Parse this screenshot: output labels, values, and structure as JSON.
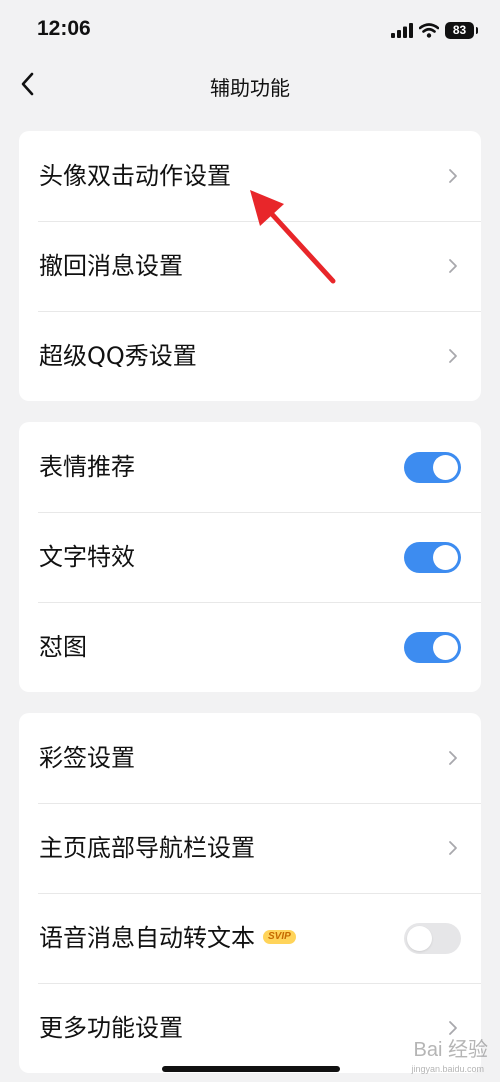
{
  "status": {
    "time": "12:06",
    "battery": "83"
  },
  "nav": {
    "title": "辅助功能"
  },
  "groups": [
    {
      "items": [
        {
          "label": "头像双击动作设置",
          "control": "chevron"
        },
        {
          "label": "撤回消息设置",
          "control": "chevron"
        },
        {
          "label": "超级QQ秀设置",
          "control": "chevron"
        }
      ]
    },
    {
      "items": [
        {
          "label": "表情推荐",
          "control": "toggle",
          "on": true
        },
        {
          "label": "文字特效",
          "control": "toggle",
          "on": true
        },
        {
          "label": "怼图",
          "control": "toggle",
          "on": true
        }
      ]
    },
    {
      "items": [
        {
          "label": "彩签设置",
          "control": "chevron"
        },
        {
          "label": "主页底部导航栏设置",
          "control": "chevron"
        },
        {
          "label": "语音消息自动转文本",
          "badge": "SVIP",
          "control": "toggle",
          "on": false
        },
        {
          "label": "更多功能设置",
          "control": "chevron"
        }
      ]
    }
  ],
  "watermark": {
    "text": "Bai 经验",
    "sub": "jingyan.baidu.com"
  },
  "colors": {
    "toggle_on": "#3d8cf0",
    "toggle_off": "#e6e6e8",
    "annotation_arrow": "#e8262a",
    "badge": "#ffd45a"
  }
}
